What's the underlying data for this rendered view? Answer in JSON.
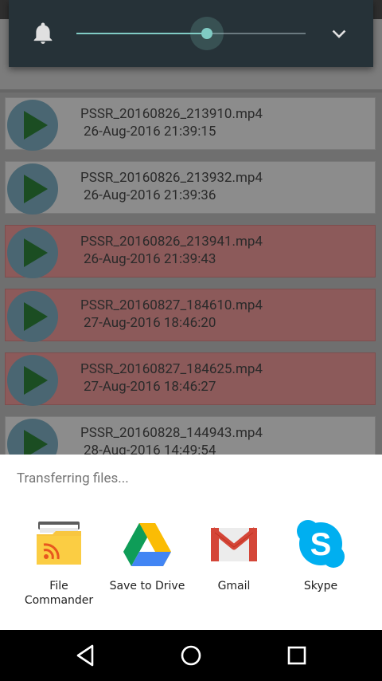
{
  "files": [
    {
      "name": "PSSR_20160826_213910.mp4",
      "date": "26-Aug-2016 21:39:15",
      "highlighted": false
    },
    {
      "name": "PSSR_20160826_213932.mp4",
      "date": "26-Aug-2016 21:39:36",
      "highlighted": false
    },
    {
      "name": "PSSR_20160826_213941.mp4",
      "date": "26-Aug-2016 21:39:43",
      "highlighted": true
    },
    {
      "name": "PSSR_20160827_184610.mp4",
      "date": "27-Aug-2016 18:46:20",
      "highlighted": true
    },
    {
      "name": "PSSR_20160827_184625.mp4",
      "date": "27-Aug-2016 18:46:27",
      "highlighted": true
    },
    {
      "name": "PSSR_20160828_144943.mp4",
      "date": "28-Aug-2016 14:49:54",
      "highlighted": false
    }
  ],
  "volume_panel": {
    "level": 0.57,
    "accent": "#80cbc4",
    "background": "#263238",
    "icons": [
      "bell-icon",
      "chevron-down-icon"
    ]
  },
  "share_sheet": {
    "title": "Transferring files...",
    "targets": [
      {
        "label": "File\nCommander",
        "icon": "file-commander-icon"
      },
      {
        "label": "Save to Drive",
        "icon": "google-drive-icon"
      },
      {
        "label": "Gmail",
        "icon": "gmail-icon"
      },
      {
        "label": "Skype",
        "icon": "skype-icon"
      }
    ]
  },
  "navbar": {
    "icons": [
      "back-icon",
      "home-icon",
      "recents-icon"
    ]
  }
}
